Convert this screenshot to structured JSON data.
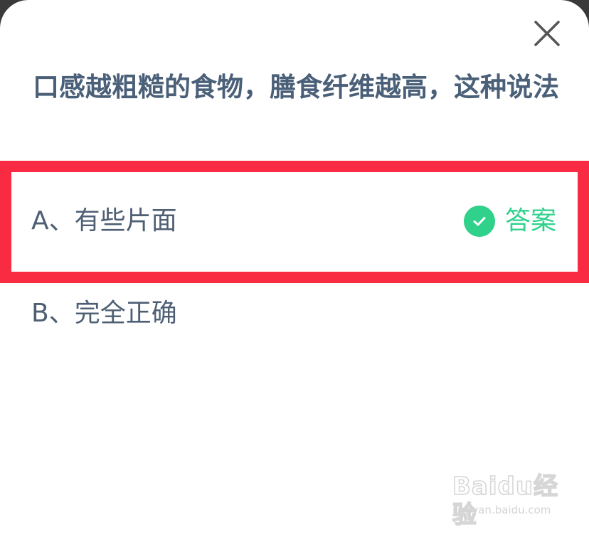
{
  "dialog": {
    "close_icon": "close-icon",
    "question": "口感越粗糙的食物，膳食纤维越高，这种说法"
  },
  "options": [
    {
      "text": "A、有些片面",
      "is_answer": true,
      "badge_label": "答案",
      "badge_icon": "check-circle-icon"
    },
    {
      "text": "B、完全正确",
      "is_answer": false
    }
  ],
  "highlight_color": "#f92b43",
  "answer_color": "#2fd18b",
  "watermark": {
    "brand": "Baidu经验",
    "url": "jingyan.baidu.com"
  }
}
